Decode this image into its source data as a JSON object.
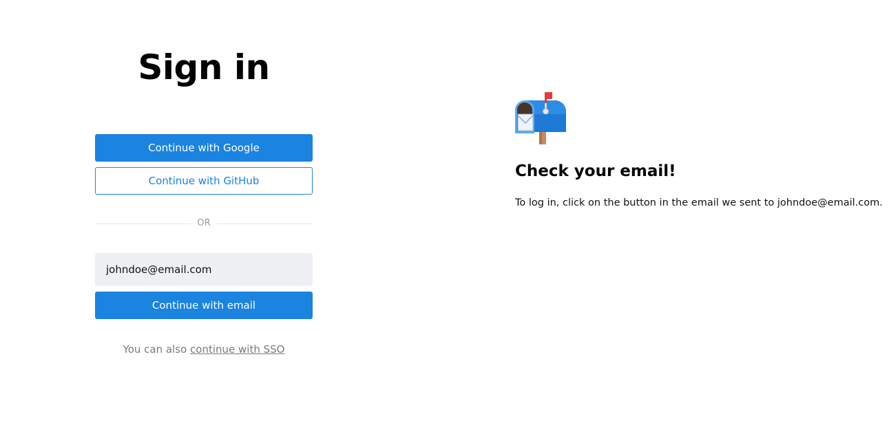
{
  "signin": {
    "title": "Sign in",
    "google_button": "Continue with Google",
    "github_button": "Continue with GitHub",
    "divider_text": "OR",
    "email_value": "johndoe@email.com",
    "email_button": "Continue with email",
    "sso_prefix": "You can also",
    "sso_link": "continue with SSO"
  },
  "confirmation": {
    "icon": "mailbox-with-raised-flag-icon",
    "title": "Check your email!",
    "message": "To log in, click on the button in the email we sent to johndoe@email.com."
  },
  "colors": {
    "primary": "#1b83e0",
    "input_background": "#eff0f4",
    "muted_text": "#7a7a7a",
    "divider": "#e6e6e6"
  }
}
